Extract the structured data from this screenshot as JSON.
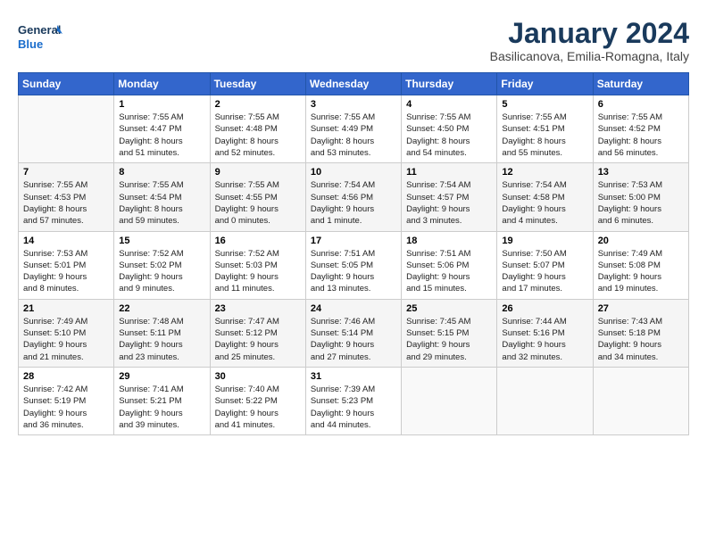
{
  "header": {
    "logo_line1": "General",
    "logo_line2": "Blue",
    "month_title": "January 2024",
    "location": "Basilicanova, Emilia-Romagna, Italy"
  },
  "weekdays": [
    "Sunday",
    "Monday",
    "Tuesday",
    "Wednesday",
    "Thursday",
    "Friday",
    "Saturday"
  ],
  "weeks": [
    [
      {
        "day": "",
        "info": ""
      },
      {
        "day": "1",
        "info": "Sunrise: 7:55 AM\nSunset: 4:47 PM\nDaylight: 8 hours\nand 51 minutes."
      },
      {
        "day": "2",
        "info": "Sunrise: 7:55 AM\nSunset: 4:48 PM\nDaylight: 8 hours\nand 52 minutes."
      },
      {
        "day": "3",
        "info": "Sunrise: 7:55 AM\nSunset: 4:49 PM\nDaylight: 8 hours\nand 53 minutes."
      },
      {
        "day": "4",
        "info": "Sunrise: 7:55 AM\nSunset: 4:50 PM\nDaylight: 8 hours\nand 54 minutes."
      },
      {
        "day": "5",
        "info": "Sunrise: 7:55 AM\nSunset: 4:51 PM\nDaylight: 8 hours\nand 55 minutes."
      },
      {
        "day": "6",
        "info": "Sunrise: 7:55 AM\nSunset: 4:52 PM\nDaylight: 8 hours\nand 56 minutes."
      }
    ],
    [
      {
        "day": "7",
        "info": "Sunrise: 7:55 AM\nSunset: 4:53 PM\nDaylight: 8 hours\nand 57 minutes."
      },
      {
        "day": "8",
        "info": "Sunrise: 7:55 AM\nSunset: 4:54 PM\nDaylight: 8 hours\nand 59 minutes."
      },
      {
        "day": "9",
        "info": "Sunrise: 7:55 AM\nSunset: 4:55 PM\nDaylight: 9 hours\nand 0 minutes."
      },
      {
        "day": "10",
        "info": "Sunrise: 7:54 AM\nSunset: 4:56 PM\nDaylight: 9 hours\nand 1 minute."
      },
      {
        "day": "11",
        "info": "Sunrise: 7:54 AM\nSunset: 4:57 PM\nDaylight: 9 hours\nand 3 minutes."
      },
      {
        "day": "12",
        "info": "Sunrise: 7:54 AM\nSunset: 4:58 PM\nDaylight: 9 hours\nand 4 minutes."
      },
      {
        "day": "13",
        "info": "Sunrise: 7:53 AM\nSunset: 5:00 PM\nDaylight: 9 hours\nand 6 minutes."
      }
    ],
    [
      {
        "day": "14",
        "info": "Sunrise: 7:53 AM\nSunset: 5:01 PM\nDaylight: 9 hours\nand 8 minutes."
      },
      {
        "day": "15",
        "info": "Sunrise: 7:52 AM\nSunset: 5:02 PM\nDaylight: 9 hours\nand 9 minutes."
      },
      {
        "day": "16",
        "info": "Sunrise: 7:52 AM\nSunset: 5:03 PM\nDaylight: 9 hours\nand 11 minutes."
      },
      {
        "day": "17",
        "info": "Sunrise: 7:51 AM\nSunset: 5:05 PM\nDaylight: 9 hours\nand 13 minutes."
      },
      {
        "day": "18",
        "info": "Sunrise: 7:51 AM\nSunset: 5:06 PM\nDaylight: 9 hours\nand 15 minutes."
      },
      {
        "day": "19",
        "info": "Sunrise: 7:50 AM\nSunset: 5:07 PM\nDaylight: 9 hours\nand 17 minutes."
      },
      {
        "day": "20",
        "info": "Sunrise: 7:49 AM\nSunset: 5:08 PM\nDaylight: 9 hours\nand 19 minutes."
      }
    ],
    [
      {
        "day": "21",
        "info": "Sunrise: 7:49 AM\nSunset: 5:10 PM\nDaylight: 9 hours\nand 21 minutes."
      },
      {
        "day": "22",
        "info": "Sunrise: 7:48 AM\nSunset: 5:11 PM\nDaylight: 9 hours\nand 23 minutes."
      },
      {
        "day": "23",
        "info": "Sunrise: 7:47 AM\nSunset: 5:12 PM\nDaylight: 9 hours\nand 25 minutes."
      },
      {
        "day": "24",
        "info": "Sunrise: 7:46 AM\nSunset: 5:14 PM\nDaylight: 9 hours\nand 27 minutes."
      },
      {
        "day": "25",
        "info": "Sunrise: 7:45 AM\nSunset: 5:15 PM\nDaylight: 9 hours\nand 29 minutes."
      },
      {
        "day": "26",
        "info": "Sunrise: 7:44 AM\nSunset: 5:16 PM\nDaylight: 9 hours\nand 32 minutes."
      },
      {
        "day": "27",
        "info": "Sunrise: 7:43 AM\nSunset: 5:18 PM\nDaylight: 9 hours\nand 34 minutes."
      }
    ],
    [
      {
        "day": "28",
        "info": "Sunrise: 7:42 AM\nSunset: 5:19 PM\nDaylight: 9 hours\nand 36 minutes."
      },
      {
        "day": "29",
        "info": "Sunrise: 7:41 AM\nSunset: 5:21 PM\nDaylight: 9 hours\nand 39 minutes."
      },
      {
        "day": "30",
        "info": "Sunrise: 7:40 AM\nSunset: 5:22 PM\nDaylight: 9 hours\nand 41 minutes."
      },
      {
        "day": "31",
        "info": "Sunrise: 7:39 AM\nSunset: 5:23 PM\nDaylight: 9 hours\nand 44 minutes."
      },
      {
        "day": "",
        "info": ""
      },
      {
        "day": "",
        "info": ""
      },
      {
        "day": "",
        "info": ""
      }
    ]
  ]
}
